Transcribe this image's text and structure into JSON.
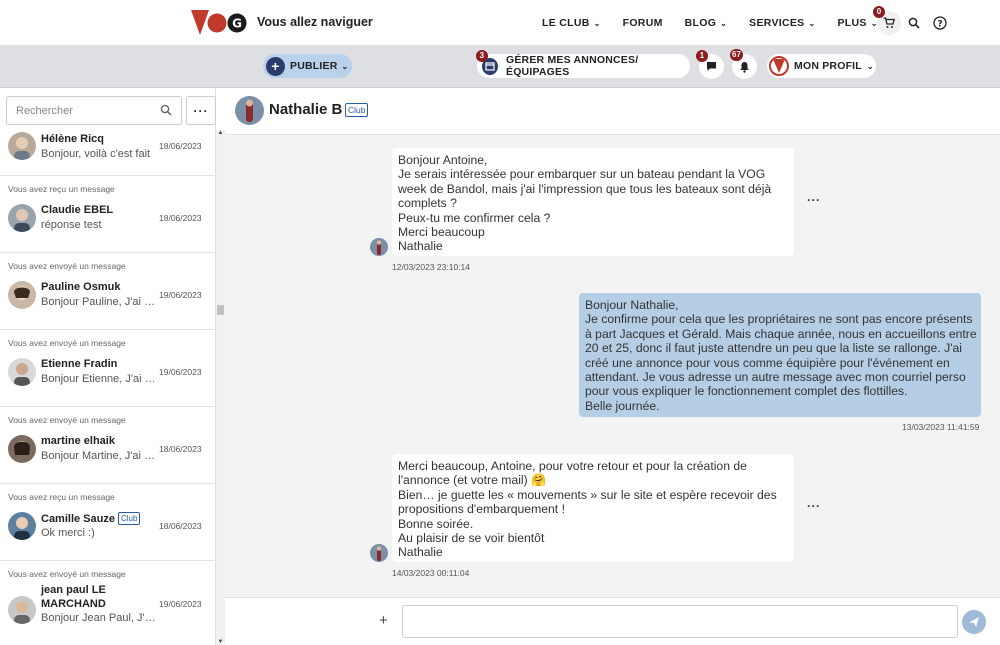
{
  "topnav": {
    "logo_text": "VOG",
    "tagline": "Vous allez naviguer",
    "links": [
      {
        "label": "LE CLUB",
        "dropdown": true
      },
      {
        "label": "FORUM",
        "dropdown": false
      },
      {
        "label": "BLOG",
        "dropdown": true
      },
      {
        "label": "SERVICES",
        "dropdown": true
      },
      {
        "label": "PLUS",
        "dropdown": true
      }
    ],
    "cart_count": "0"
  },
  "toolbar": {
    "publier_label": "PUBLIER",
    "gerer_label": "GÉRER MES ANNONCES/ÉQUIPAGES",
    "gerer_count": "3",
    "messages_count": "1",
    "notifications_count": "67",
    "profil_label": "MON PROFIL"
  },
  "search": {
    "placeholder": "Rechercher"
  },
  "conversations": [
    {
      "kind": "",
      "name": "Hélène Ricq",
      "club": false,
      "preview": "Bonjour, voilà c'est fait",
      "date": "18/06/2023"
    },
    {
      "kind": "Vous avez reçu un message",
      "name": "Claudie EBEL",
      "club": false,
      "preview": "réponse test",
      "date": "18/06/2023"
    },
    {
      "kind": "Vous avez envoyé un message",
      "name": "Pauline Osmuk",
      "club": false,
      "preview": "Bonjour Pauline, J'ai bien",
      "date": "19/06/2023"
    },
    {
      "kind": "Vous avez envoyé un message",
      "name": "Etienne Fradin",
      "club": false,
      "preview": "Bonjour Etienne, J'ai bien",
      "date": "19/06/2023"
    },
    {
      "kind": "Vous avez envoyé un message",
      "name": "martine elhaik",
      "club": false,
      "preview": "Bonjour Martine, J'ai bien",
      "date": "18/06/2023"
    },
    {
      "kind": "Vous avez reçu un message",
      "name": "Camille Sauze",
      "club": true,
      "preview": "Ok merci :)",
      "date": "18/06/2023"
    },
    {
      "kind": "Vous avez envoyé un message",
      "name": "jean paul LE MARCHAND",
      "club": false,
      "preview": "Bonjour Jean Paul, J'ai bien",
      "date": "19/06/2023"
    }
  ],
  "club_tag": "Club",
  "chat": {
    "contact_name": "Nathalie B",
    "contact_tag": "Club",
    "messages": [
      {
        "direction": "in",
        "text": "Bonjour Antoine,\nJe serais intéressée pour embarquer sur un bateau pendant la VOG week de Bandol, mais j'ai l'impression que tous les bateaux sont déjà complets ?\nPeux-tu me confirmer cela ?\nMerci beaucoup\nNathalie",
        "timestamp": "12/03/2023 23:10:14"
      },
      {
        "direction": "out",
        "text": "Bonjour Nathalie,\nJe confirme pour cela que les propriétaires ne sont pas encore présents à part Jacques et Gérald. Mais chaque année, nous en accueillons entre 20 et 25, donc il faut juste attendre un peu que la liste se rallonge. J'ai créé une annonce pour vous comme équipière pour l'événement en attendant. Je vous adresse un autre message avec mon courriel perso pour vous expliquer le fonctionnement complet des flottilles.\nBelle journée.",
        "timestamp": "13/03/2023 11:41:59"
      },
      {
        "direction": "in",
        "text": "Merci beaucoup, Antoine, pour votre retour et pour la création de l'annonce (et votre mail) 🤗\nBien… je guette les « mouvements » sur le site et espère recevoir des propositions d'embarquement !\nBonne soirée.\nAu plaisir de se voir bientôt\nNathalie",
        "timestamp": "14/03/2023 00:11:04"
      }
    ]
  },
  "composer": {
    "value": ""
  },
  "colors": {
    "brand_red": "#c0392b",
    "brand_navy": "#2b3b6e",
    "outgoing_bubble": "#b6cde6",
    "badge": "#8b1d1d"
  }
}
